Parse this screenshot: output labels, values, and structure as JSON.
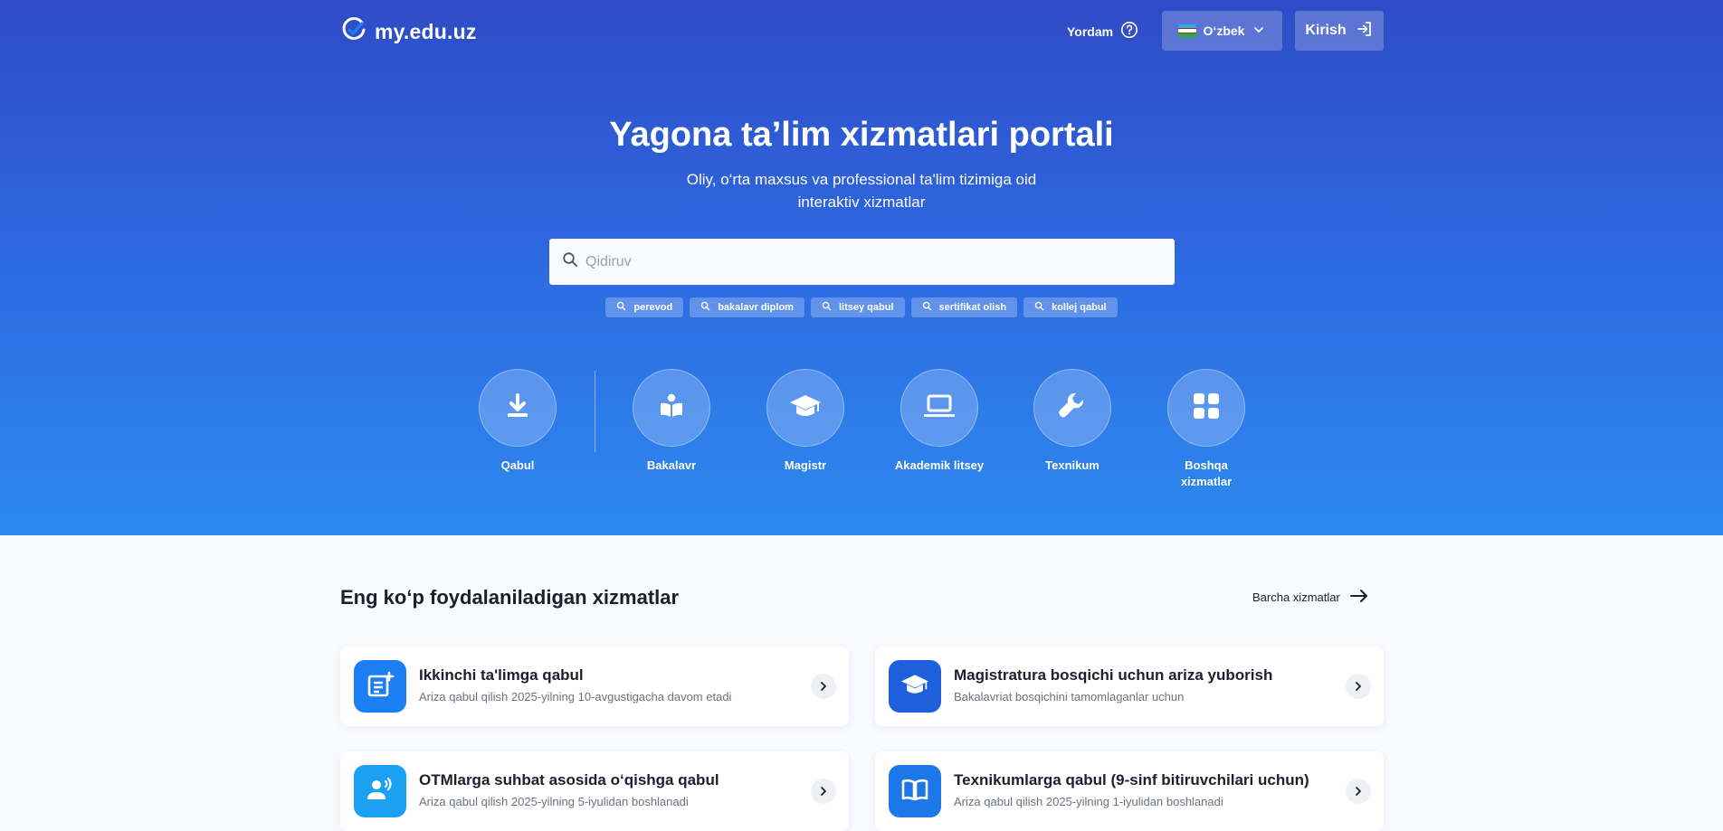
{
  "brand": {
    "name": "my.edu.uz"
  },
  "header": {
    "help_label": "Yordam",
    "language_label": "O‘zbek",
    "login_label": "Kirish"
  },
  "hero": {
    "title": "Yagona ta’lim xizmatlari portali",
    "subtitle": "Oliy, o‘rta maxsus va professional ta'lim tizimiga oid interaktiv xizmatlar"
  },
  "search": {
    "placeholder": "Qidiruv",
    "suggestions": [
      "perevod",
      "bakalavr diplom",
      "litsey qabul",
      "sertifikat olish",
      "kollej qabul"
    ]
  },
  "categories": [
    {
      "label": "Qabul",
      "icon": "download-icon"
    },
    {
      "label": "Bakalavr",
      "icon": "reading-book-icon"
    },
    {
      "label": "Magistr",
      "icon": "graduation-cap-icon"
    },
    {
      "label": "Akademik litsey",
      "icon": "laptop-icon"
    },
    {
      "label": "Texnikum",
      "icon": "wrench-icon"
    },
    {
      "label": "Boshqa xizmatlar",
      "icon": "grid-icon"
    }
  ],
  "popular": {
    "title": "Eng ko‘p foydalaniladigan xizmatlar",
    "all_label": "Barcha xizmatlar",
    "cards": [
      {
        "title": "Ikkinchi ta'limga qabul",
        "desc": "Ariza qabul qilish 2025-yilning 10-avgustigacha davom etadi",
        "icon": "document-add-icon",
        "color": "#1c7ef3"
      },
      {
        "title": "Magistratura bosqichi uchun ariza yuborish",
        "desc": "Bakalavriat bosqichini tamomlaganlar uchun",
        "icon": "graduation-cap-icon",
        "color": "#1e5fdc"
      },
      {
        "title": "OTMlarga suhbat asosida o‘qishga qabul",
        "desc": "Ariza qabul qilish 2025-yilning 5-iyulidan boshlanadi",
        "icon": "speaking-person-icon",
        "color": "#1ca0f2"
      },
      {
        "title": "Texnikumlarga qabul (9-sinf bitiruvchilari uchun)",
        "desc": "Ariza qabul qilish 2025-yilning 1-iyulidan boshlanadi",
        "icon": "open-book-icon",
        "color": "#1c78e8"
      }
    ]
  },
  "colors": {
    "hero_top": "#2f4bc6",
    "hero_bottom": "#2d89ef",
    "flag_blue": "#1eb4e6",
    "flag_green": "#1eb53a"
  }
}
